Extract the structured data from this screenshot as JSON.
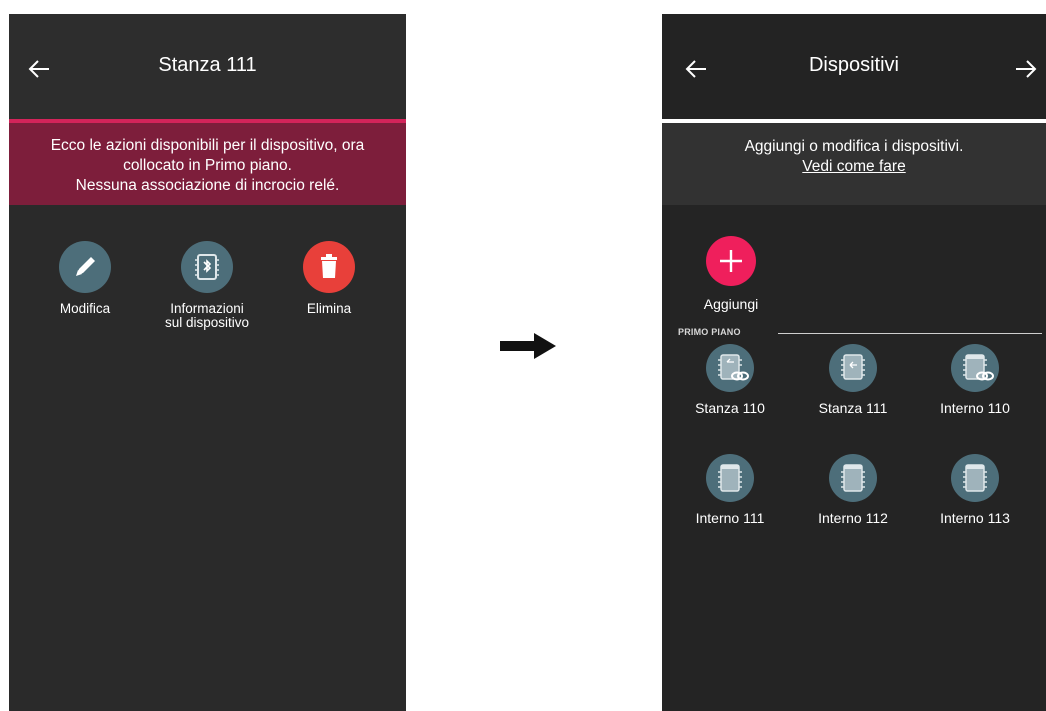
{
  "left_screen": {
    "title": "Stanza 111",
    "banner": {
      "line1": "Ecco le azioni disponibili per il dispositivo, ora",
      "line2": "collocato in Primo piano.",
      "line3": "Nessuna associazione di incrocio relé."
    },
    "actions": [
      {
        "label_l1": "Modifica",
        "label_l2": "",
        "icon": "pencil-icon",
        "color": "#4d6e7a"
      },
      {
        "label_l1": "Informazioni",
        "label_l2": "sul dispositivo",
        "icon": "bluetooth-chip-icon",
        "color": "#4d6e7a"
      },
      {
        "label_l1": "Elimina",
        "label_l2": "",
        "icon": "trash-icon",
        "color": "#e8403a"
      }
    ]
  },
  "right_screen": {
    "title": "Dispositivi",
    "info": {
      "text": "Aggiungi o modifica i dispositivi.",
      "link": "Vedi come fare"
    },
    "add_label": "Aggiungi",
    "section_label": "PRIMO PIANO",
    "devices": [
      {
        "label": "Stanza 110",
        "icon": "linked-device-icon"
      },
      {
        "label": "Stanza 111",
        "icon": "device-icon"
      },
      {
        "label": "Interno 110",
        "icon": "linked-device-icon"
      },
      {
        "label": "Interno 111",
        "icon": "device-icon"
      },
      {
        "label": "Interno 112",
        "icon": "device-icon"
      },
      {
        "label": "Interno 113",
        "icon": "device-icon"
      }
    ]
  },
  "colors": {
    "accent": "#ef1f5c",
    "banner": "#7d1e3b",
    "device_circle": "#4d6e7a",
    "delete": "#e8403a"
  }
}
